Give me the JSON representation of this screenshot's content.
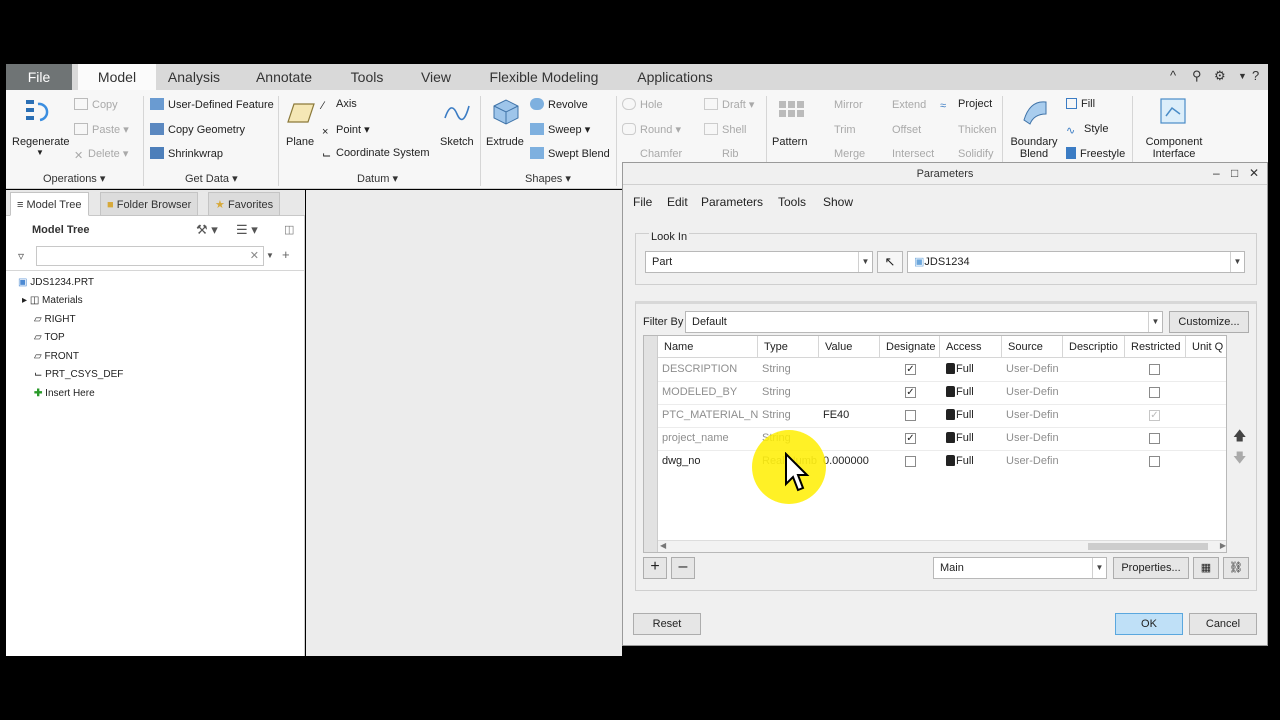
{
  "tabs": {
    "file": "File",
    "items": [
      "Model",
      "Analysis",
      "Annotate",
      "Tools",
      "View",
      "Flexible Modeling",
      "Applications"
    ]
  },
  "ribbon": {
    "regenerate": "Regenerate",
    "copy": "Copy",
    "paste": "Paste",
    "delete": "Delete",
    "user_defined_feature": "User-Defined Feature",
    "copy_geometry": "Copy Geometry",
    "shrinkwrap": "Shrinkwrap",
    "plane": "Plane",
    "axis": "Axis",
    "point": "Point",
    "coordinate_system": "Coordinate System",
    "sketch": "Sketch",
    "extrude": "Extrude",
    "revolve": "Revolve",
    "sweep": "Sweep",
    "swept_blend": "Swept Blend",
    "hole": "Hole",
    "draft": "Draft",
    "round": "Round",
    "shell": "Shell",
    "chamfer": "Chamfer",
    "rib": "Rib",
    "pattern": "Pattern",
    "mirror": "Mirror",
    "extend": "Extend",
    "project": "Project",
    "trim": "Trim",
    "offset": "Offset",
    "thicken": "Thicken",
    "merge": "Merge",
    "intersect": "Intersect",
    "solidify": "Solidify",
    "boundary_blend": "Boundary Blend",
    "fill": "Fill",
    "style": "Style",
    "freestyle": "Freestyle",
    "component_interface": "Component Interface",
    "groups": {
      "operations": "Operations",
      "get_data": "Get Data",
      "datum": "Datum",
      "shapes": "Shapes"
    }
  },
  "left_panel": {
    "tabs": [
      "Model Tree",
      "Folder Browser",
      "Favorites"
    ],
    "title": "Model Tree",
    "tree": [
      "JDS1234.PRT",
      "Materials",
      "RIGHT",
      "TOP",
      "FRONT",
      "PRT_CSYS_DEF",
      "Insert Here"
    ]
  },
  "dialog": {
    "title": "Parameters",
    "menu": [
      "File",
      "Edit",
      "Parameters",
      "Tools",
      "Show"
    ],
    "look_in_label": "Look In",
    "look_in_value": "Part",
    "part_name": "JDS1234",
    "filter_by_label": "Filter By",
    "filter_value": "Default",
    "customize_button": "Customize...",
    "columns": [
      "Name",
      "Type",
      "Value",
      "Designate",
      "Access",
      "Source",
      "Descriptio",
      "Restricted",
      "Unit Q"
    ],
    "rows": [
      {
        "name": "DESCRIPTION",
        "type": "String",
        "value": "",
        "designate": true,
        "access": "Full",
        "source": "User-Defin",
        "restricted": false
      },
      {
        "name": "MODELED_BY",
        "type": "String",
        "value": "",
        "designate": true,
        "access": "Full",
        "source": "User-Defin",
        "restricted": false
      },
      {
        "name": "PTC_MATERIAL_NA",
        "type": "String",
        "value": "FE40",
        "designate": false,
        "access": "Full",
        "source": "User-Defin",
        "restricted": true
      },
      {
        "name": "project_name",
        "type": "String",
        "value": "",
        "designate": true,
        "access": "Full",
        "source": "User-Defin",
        "restricted": false
      },
      {
        "name": "dwg_no",
        "type": "Real Numb",
        "value": "0.000000",
        "designate": false,
        "access": "Full",
        "source": "User-Defin",
        "restricted": false
      }
    ],
    "scope_value": "Main",
    "properties_button": "Properties...",
    "reset_button": "Reset",
    "ok_button": "OK",
    "cancel_button": "Cancel"
  },
  "colors": {
    "file_tab": "#6f7475",
    "ok_button": "#bfe0f7",
    "highlight": "#ffee00"
  }
}
